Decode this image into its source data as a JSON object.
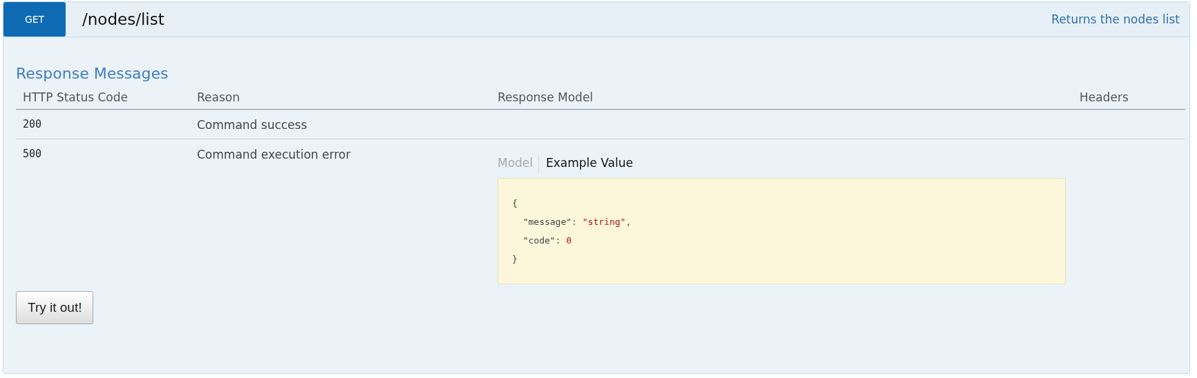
{
  "endpoint": {
    "method": "GET",
    "path": "/nodes/list",
    "summary": "Returns the nodes list"
  },
  "responses": {
    "title": "Response Messages",
    "columns": [
      "HTTP Status Code",
      "Reason",
      "Response Model",
      "Headers"
    ],
    "rows": [
      {
        "status": "200",
        "reason": "Command success"
      },
      {
        "status": "500",
        "reason": "Command execution error",
        "model": {
          "tabs": [
            {
              "label": "Model",
              "selected": false
            },
            {
              "label": "Example Value",
              "selected": true
            }
          ],
          "example": [
            [
              {
                "text": "{",
                "kind": "punct"
              }
            ],
            [
              {
                "text": "  \"message\": ",
                "kind": "key"
              },
              {
                "text": "\"string\"",
                "kind": "string"
              },
              {
                "text": ",",
                "kind": "punct"
              }
            ],
            [
              {
                "text": "  \"code\": ",
                "kind": "key"
              },
              {
                "text": "0",
                "kind": "number"
              }
            ],
            [
              {
                "text": "}",
                "kind": "punct"
              }
            ]
          ]
        }
      }
    ]
  },
  "try_button": "Try it out!"
}
